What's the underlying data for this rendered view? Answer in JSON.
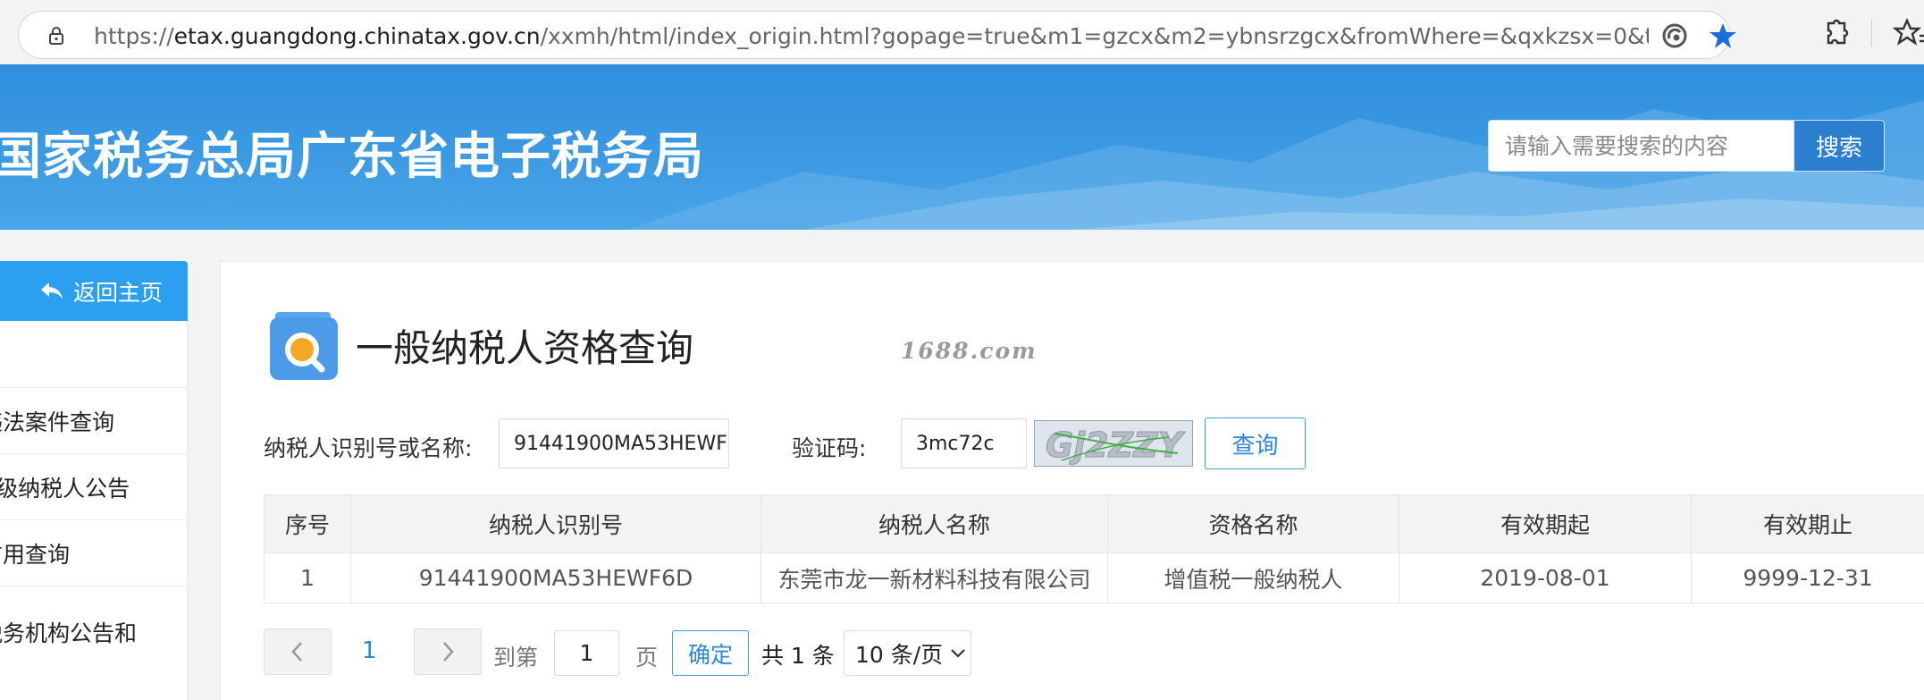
{
  "browser": {
    "url_prefix": "https://",
    "url_host": "etax.guangdong.chinatax.gov.cn",
    "url_path": "/xxmh/html/index_origin.html?gopage=true&m1=gzcx&m2=ybnsrzgcx&fromWhere=&qxkzsx=0&tabTitle=null&cdId=..."
  },
  "header": {
    "site_title": "国家税务总局广东省电子税务局",
    "search_placeholder": "请输入需要搜索的内容",
    "search_button": "搜索"
  },
  "sidebar": {
    "back_label": "返回主页",
    "items": [
      {
        "label": "违法案件查询"
      },
      {
        "label": "A级纳税人公告"
      },
      {
        "label": "信用查询"
      },
      {
        "label": "税务机构公告和"
      }
    ]
  },
  "main": {
    "title": "一般纳税人资格查询",
    "watermark": "1688.com",
    "taxpayer_label": "纳税人识别号或名称:",
    "taxpayer_value": "91441900MA53HEWF6D",
    "captcha_label": "验证码:",
    "captcha_value": "3mc72c",
    "captcha_image_text": "Gj2ZZY",
    "query_button": "查询"
  },
  "table": {
    "headers": [
      "序号",
      "纳税人识别号",
      "纳税人名称",
      "资格名称",
      "有效期起",
      "有效期止"
    ],
    "rows": [
      [
        "1",
        "91441900MA53HEWF6D",
        "东莞市龙一新材料科技有限公司",
        "增值税一般纳税人",
        "2019-08-01",
        "9999-12-31"
      ]
    ]
  },
  "pagination": {
    "current_page": "1",
    "goto_prefix": "到第",
    "goto_value": "1",
    "goto_suffix": "页",
    "confirm": "确定",
    "total": "共 1 条",
    "page_size": "10 条/页"
  },
  "colors": {
    "banner_blue": "#3c9ae3",
    "accent_blue": "#2d9ff0",
    "link_blue": "#2f86d6"
  }
}
